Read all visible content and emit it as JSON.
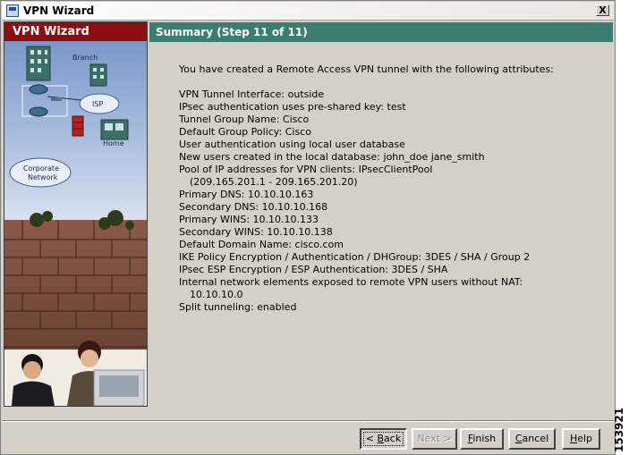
{
  "window": {
    "title": "VPN Wizard",
    "close_label": "X"
  },
  "sidebar": {
    "title": "VPN Wizard",
    "art": {
      "branch": "Branch",
      "isp": "ISP",
      "home": "Home",
      "corporate": "Corporate",
      "network": "Network"
    }
  },
  "header": {
    "title": "Summary  (Step 11 of 11)"
  },
  "summary": {
    "intro": "You have created a Remote Access VPN tunnel with the following attributes:",
    "lines": [
      "VPN Tunnel Interface: outside",
      "IPsec authentication uses pre-shared key: test",
      "Tunnel Group Name: Cisco",
      "Default Group Policy: Cisco",
      "User authentication using local user database",
      "New users created in the local database: john_doe jane_smith",
      "Pool of IP addresses for VPN clients: IPsecClientPool",
      "(209.165.201.1 - 209.165.201.20)",
      "Primary DNS: 10.10.10.163",
      "Secondary DNS: 10.10.10.168",
      "Primary WINS: 10.10.10.133",
      "Secondary WINS: 10.10.10.138",
      "Default Domain Name: cisco.com",
      "IKE Policy Encryption / Authentication / DHGroup: 3DES / SHA / Group 2",
      "IPsec ESP Encryption / ESP Authentication: 3DES / SHA",
      "Internal network elements exposed to remote VPN users without NAT:",
      "10.10.10.0",
      "Split tunneling: enabled"
    ]
  },
  "buttons": {
    "back": {
      "prefix": "< ",
      "mnemonic": "B",
      "rest": "ack"
    },
    "next": "Next >",
    "finish": {
      "mnemonic": "F",
      "rest": "inish"
    },
    "cancel": {
      "mnemonic": "C",
      "rest": "ancel"
    },
    "help": {
      "mnemonic": "H",
      "rest": "elp"
    }
  },
  "figure_id": "153921"
}
